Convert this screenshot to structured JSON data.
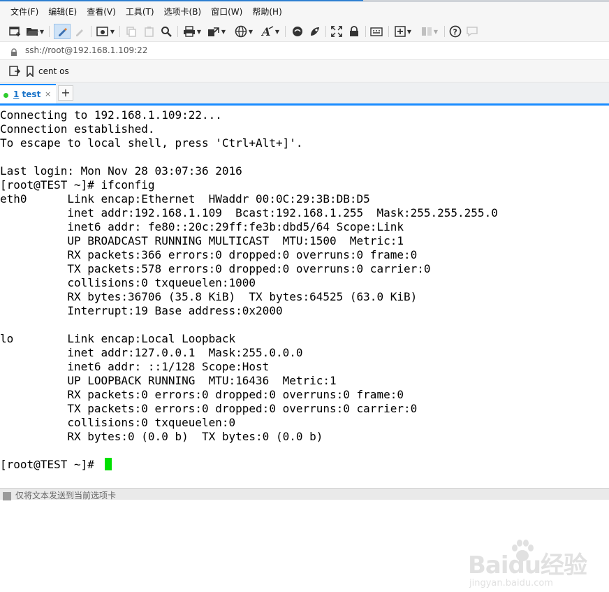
{
  "menu": [
    "文件(F)",
    "编辑(E)",
    "查看(V)",
    "工具(T)",
    "选项卡(B)",
    "窗口(W)",
    "帮助(H)"
  ],
  "address": {
    "url": "ssh://root@192.168.1.109:22"
  },
  "session_bar": {
    "label": "cent os"
  },
  "tabs": [
    {
      "number": "1",
      "name": "test",
      "close": "×"
    }
  ],
  "new_tab": "+",
  "terminal": {
    "lines": [
      "Connecting to 192.168.1.109:22...",
      "Connection established.",
      "To escape to local shell, press 'Ctrl+Alt+]'.",
      "",
      "Last login: Mon Nov 28 03:07:36 2016",
      "[root@TEST ~]# ifconfig",
      "eth0      Link encap:Ethernet  HWaddr 00:0C:29:3B:DB:D5",
      "          inet addr:192.168.1.109  Bcast:192.168.1.255  Mask:255.255.255.0",
      "          inet6 addr: fe80::20c:29ff:fe3b:dbd5/64 Scope:Link",
      "          UP BROADCAST RUNNING MULTICAST  MTU:1500  Metric:1",
      "          RX packets:366 errors:0 dropped:0 overruns:0 frame:0",
      "          TX packets:578 errors:0 dropped:0 overruns:0 carrier:0",
      "          collisions:0 txqueuelen:1000",
      "          RX bytes:36706 (35.8 KiB)  TX bytes:64525 (63.0 KiB)",
      "          Interrupt:19 Base address:0x2000",
      "",
      "lo        Link encap:Local Loopback",
      "          inet addr:127.0.0.1  Mask:255.0.0.0",
      "          inet6 addr: ::1/128 Scope:Host",
      "          UP LOOPBACK RUNNING  MTU:16436  Metric:1",
      "          RX packets:0 errors:0 dropped:0 overruns:0 frame:0",
      "          TX packets:0 errors:0 dropped:0 overruns:0 carrier:0",
      "          collisions:0 txqueuelen:0",
      "          RX bytes:0 (0.0 b)  TX bytes:0 (0.0 b)",
      "",
      "[root@TEST ~]# "
    ]
  },
  "status_bar": {
    "text": "仅将文本发送到当前选项卡"
  },
  "watermark": {
    "brand": "Baidu经验",
    "site": "jingyan.baidu.com"
  },
  "colors": {
    "accent": "#1a8cff",
    "cursor": "#00e000",
    "tab_dot": "#2ecc2e"
  }
}
